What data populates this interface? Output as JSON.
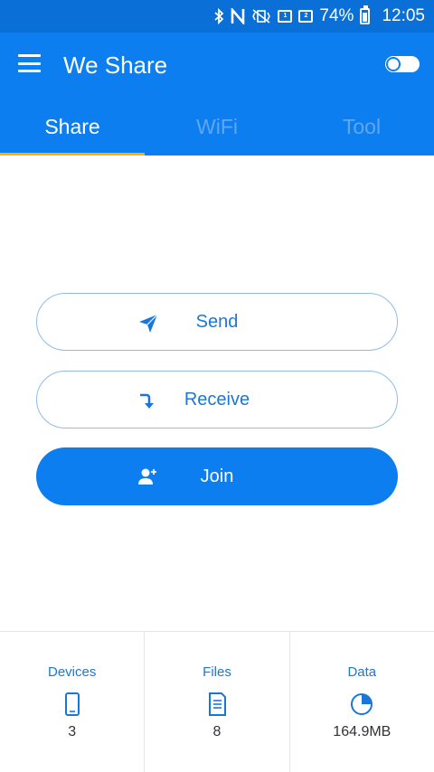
{
  "status_bar": {
    "battery_percent": "74%",
    "time": "12:05",
    "icons": [
      "bluetooth-icon",
      "nfc-icon",
      "vibrate-icon",
      "sim1-icon",
      "sim2-icon",
      "battery-icon"
    ]
  },
  "app_bar": {
    "title": "We Share",
    "menu_icon": "hamburger-menu-icon",
    "toggle_icon": "toggle-switch-icon"
  },
  "tabs": [
    {
      "label": "Share",
      "active": true
    },
    {
      "label": "WiFi",
      "active": false
    },
    {
      "label": "Tool",
      "active": false
    }
  ],
  "actions": {
    "send_label": "Send",
    "receive_label": "Receive",
    "join_label": "Join"
  },
  "stats": {
    "devices": {
      "label": "Devices",
      "value": "3",
      "icon": "phone-icon"
    },
    "files": {
      "label": "Files",
      "value": "8",
      "icon": "document-icon"
    },
    "data": {
      "label": "Data",
      "value": "164.9MB",
      "icon": "pie-chart-icon"
    }
  },
  "colors": {
    "primary": "#0c7ef0",
    "status_bar": "#0a6fd6",
    "tab_indicator": "#f5b400",
    "accent_text": "#1a77d8"
  }
}
